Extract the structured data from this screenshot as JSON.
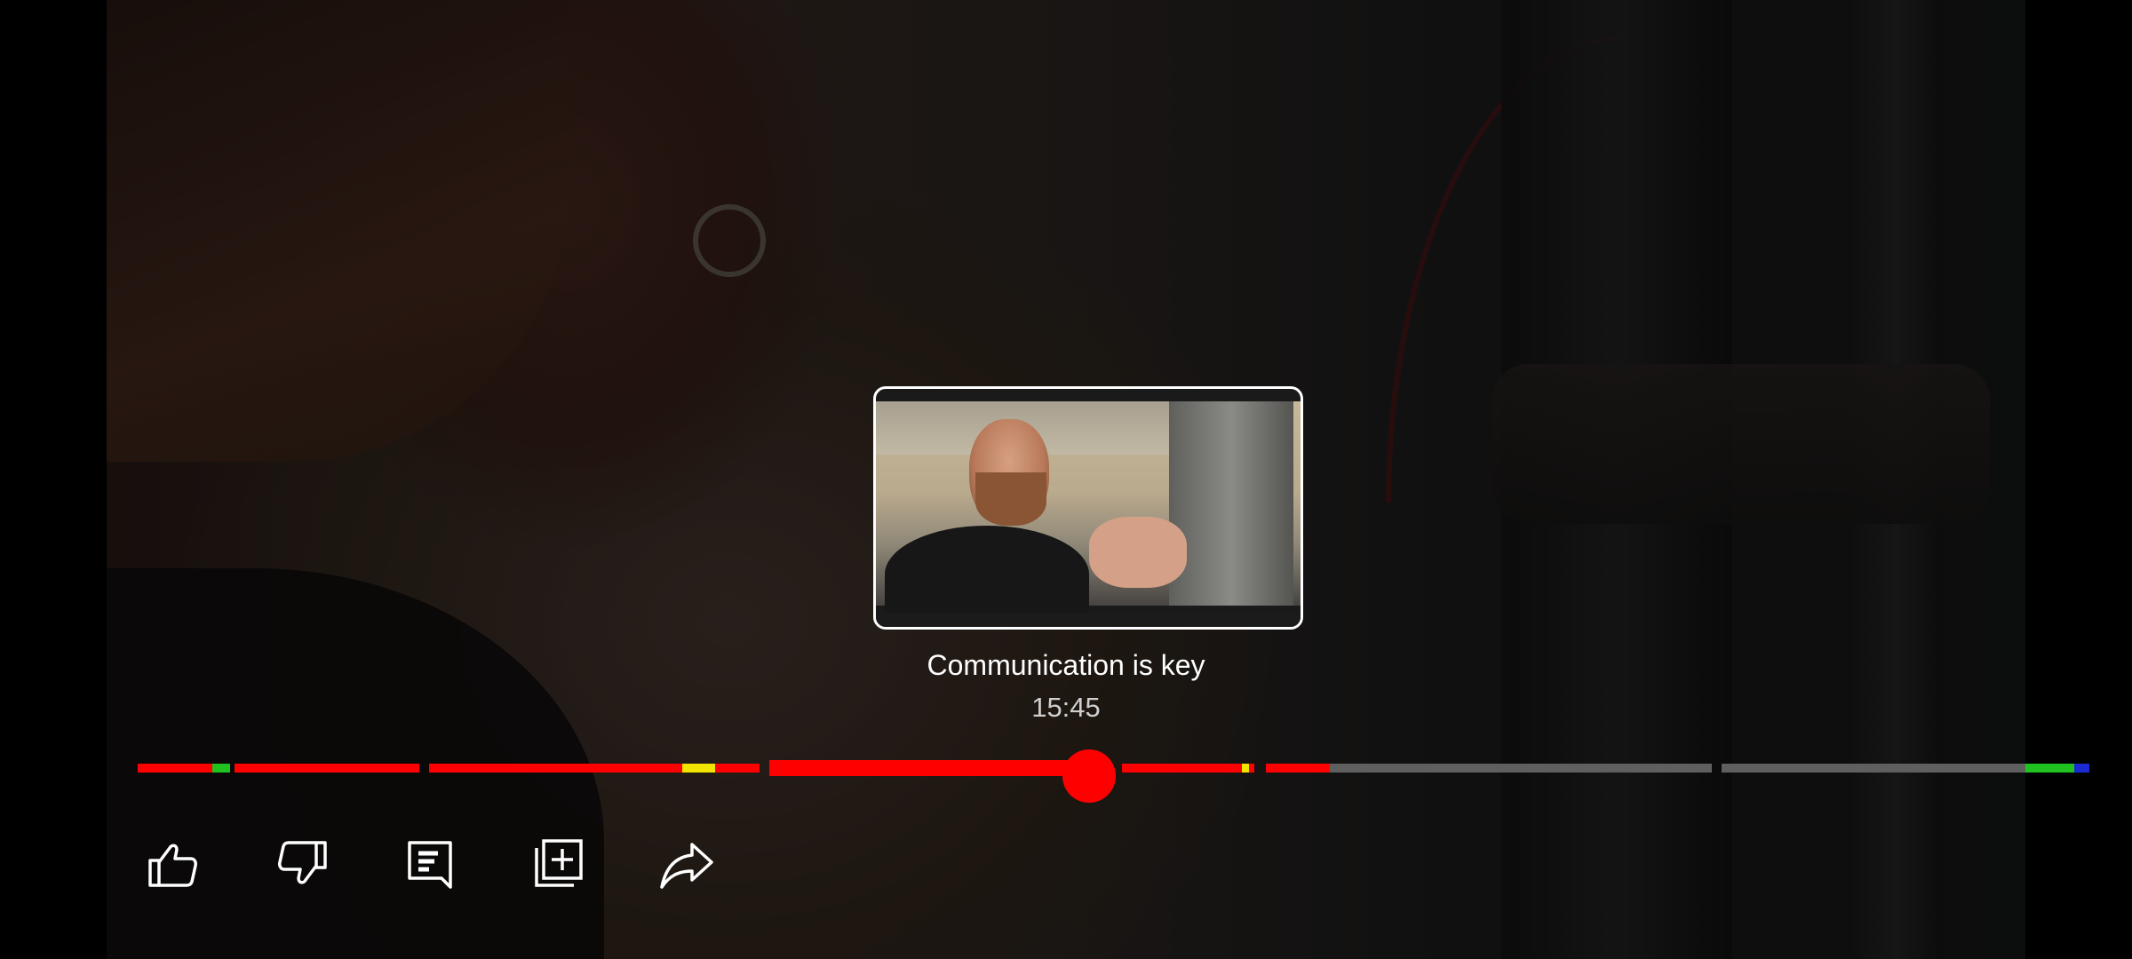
{
  "preview": {
    "chapter_title": "Communication is key",
    "timestamp": "15:45"
  },
  "progress": {
    "played_fraction": 0.49,
    "colors": {
      "played": "#ff0000",
      "unplayed": "#5f5f5f",
      "highlight_green": "#1fc21f",
      "highlight_yellow": "#f1e400",
      "highlight_blue": "#1a2bd4"
    }
  },
  "actions": [
    {
      "name": "like",
      "icon": "thumbs-up-icon"
    },
    {
      "name": "dislike",
      "icon": "thumbs-down-icon"
    },
    {
      "name": "comments",
      "icon": "comment-icon"
    },
    {
      "name": "save",
      "icon": "add-to-playlist-icon"
    },
    {
      "name": "share",
      "icon": "share-icon"
    }
  ]
}
